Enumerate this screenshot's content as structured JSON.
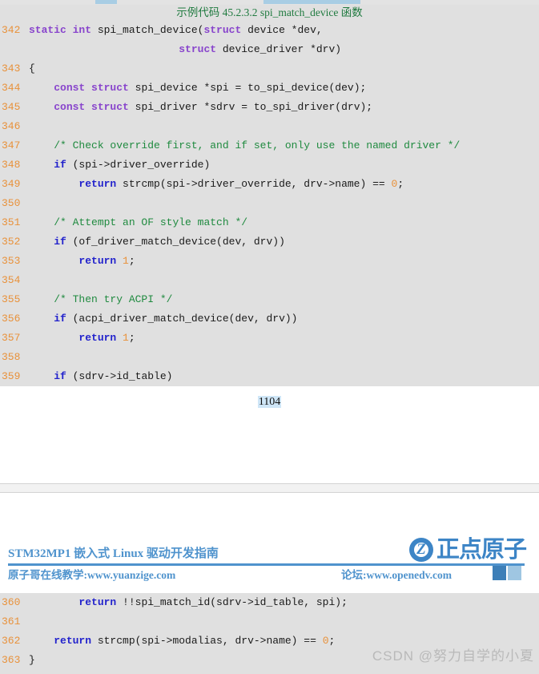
{
  "document": {
    "title": "STM32MP1 嵌入式 Linux 驱动开发指南",
    "subtitle_left": "原子哥在线教学:www.yuanzige.com",
    "subtitle_right": "论坛:www.openedv.com",
    "logo_text": "正点原子",
    "logo_mark": "atom-z-logo-icon",
    "page_number": "1104",
    "watermark": "CSDN @努力自学的小夏"
  },
  "listing": {
    "caption": "示例代码 45.2.3.2 spi_match_device 函数",
    "lines_page1": [
      {
        "n": "342",
        "parts": [
          {
            "t": "static int ",
            "c": "ty"
          },
          {
            "t": "spi_match_device(",
            "c": "pl"
          },
          {
            "t": "struct",
            "c": "ty"
          },
          {
            "t": " device *dev,",
            "c": "pl"
          }
        ]
      },
      {
        "n": "",
        "parts": [
          {
            "t": "                        ",
            "c": "pl"
          },
          {
            "t": "struct",
            "c": "ty"
          },
          {
            "t": " device_driver *drv)",
            "c": "pl"
          }
        ]
      },
      {
        "n": "343",
        "parts": [
          {
            "t": "{",
            "c": "pl"
          }
        ]
      },
      {
        "n": "344",
        "parts": [
          {
            "t": "    ",
            "c": "pl"
          },
          {
            "t": "const struct",
            "c": "ty"
          },
          {
            "t": " spi_device *spi = to_spi_device(dev);",
            "c": "pl"
          }
        ]
      },
      {
        "n": "345",
        "parts": [
          {
            "t": "    ",
            "c": "pl"
          },
          {
            "t": "const struct",
            "c": "ty"
          },
          {
            "t": " spi_driver *sdrv = to_spi_driver(drv);",
            "c": "pl"
          }
        ]
      },
      {
        "n": "346",
        "parts": [
          {
            "t": "",
            "c": "pl"
          }
        ]
      },
      {
        "n": "347",
        "parts": [
          {
            "t": "    ",
            "c": "pl"
          },
          {
            "t": "/* Check override first, and if set, only use the named driver */",
            "c": "cmt"
          }
        ]
      },
      {
        "n": "348",
        "parts": [
          {
            "t": "    ",
            "c": "pl"
          },
          {
            "t": "if",
            "c": "kw"
          },
          {
            "t": " (spi->driver_override)",
            "c": "pl"
          }
        ]
      },
      {
        "n": "349",
        "parts": [
          {
            "t": "        ",
            "c": "pl"
          },
          {
            "t": "return",
            "c": "kw"
          },
          {
            "t": " strcmp(spi->driver_override, drv->name) == ",
            "c": "pl"
          },
          {
            "t": "0",
            "c": "num"
          },
          {
            "t": ";",
            "c": "pl"
          }
        ]
      },
      {
        "n": "350",
        "parts": [
          {
            "t": "",
            "c": "pl"
          }
        ]
      },
      {
        "n": "351",
        "parts": [
          {
            "t": "    ",
            "c": "pl"
          },
          {
            "t": "/* Attempt an OF style match */",
            "c": "cmt"
          }
        ]
      },
      {
        "n": "352",
        "parts": [
          {
            "t": "    ",
            "c": "pl"
          },
          {
            "t": "if",
            "c": "kw"
          },
          {
            "t": " (of_driver_match_device(dev, drv))",
            "c": "pl"
          }
        ]
      },
      {
        "n": "353",
        "parts": [
          {
            "t": "        ",
            "c": "pl"
          },
          {
            "t": "return",
            "c": "kw"
          },
          {
            "t": " ",
            "c": "pl"
          },
          {
            "t": "1",
            "c": "num"
          },
          {
            "t": ";",
            "c": "pl"
          }
        ]
      },
      {
        "n": "354",
        "parts": [
          {
            "t": "",
            "c": "pl"
          }
        ]
      },
      {
        "n": "355",
        "parts": [
          {
            "t": "    ",
            "c": "pl"
          },
          {
            "t": "/* Then try ACPI */",
            "c": "cmt"
          }
        ]
      },
      {
        "n": "356",
        "parts": [
          {
            "t": "    ",
            "c": "pl"
          },
          {
            "t": "if",
            "c": "kw"
          },
          {
            "t": " (acpi_driver_match_device(dev, drv))",
            "c": "pl"
          }
        ]
      },
      {
        "n": "357",
        "parts": [
          {
            "t": "        ",
            "c": "pl"
          },
          {
            "t": "return",
            "c": "kw"
          },
          {
            "t": " ",
            "c": "pl"
          },
          {
            "t": "1",
            "c": "num"
          },
          {
            "t": ";",
            "c": "pl"
          }
        ]
      },
      {
        "n": "358",
        "parts": [
          {
            "t": "",
            "c": "pl"
          }
        ]
      },
      {
        "n": "359",
        "parts": [
          {
            "t": "    ",
            "c": "pl"
          },
          {
            "t": "if",
            "c": "kw"
          },
          {
            "t": " (sdrv->id_table)",
            "c": "pl"
          }
        ]
      }
    ],
    "lines_page2": [
      {
        "n": "360",
        "parts": [
          {
            "t": "        ",
            "c": "pl"
          },
          {
            "t": "return",
            "c": "kw"
          },
          {
            "t": " !!spi_match_id(sdrv->id_table, spi);",
            "c": "pl"
          }
        ]
      },
      {
        "n": "361",
        "parts": [
          {
            "t": "",
            "c": "pl"
          }
        ]
      },
      {
        "n": "362",
        "parts": [
          {
            "t": "    ",
            "c": "pl"
          },
          {
            "t": "return",
            "c": "kw"
          },
          {
            "t": " strcmp(spi->modalias, drv->name) == ",
            "c": "pl"
          },
          {
            "t": "0",
            "c": "num"
          },
          {
            "t": ";",
            "c": "pl"
          }
        ]
      },
      {
        "n": "363",
        "parts": [
          {
            "t": "}",
            "c": "pl"
          }
        ]
      }
    ]
  },
  "colors": {
    "code_background": "#e0e0e0",
    "line_number": "#e8913a",
    "keyword": "#2222cc",
    "type": "#8844cc",
    "comment": "#1f8a3f",
    "number": "#e8913a",
    "brand": "#4f93cd",
    "selection": "#a8cde4",
    "watermark": "#b9b9b9"
  }
}
